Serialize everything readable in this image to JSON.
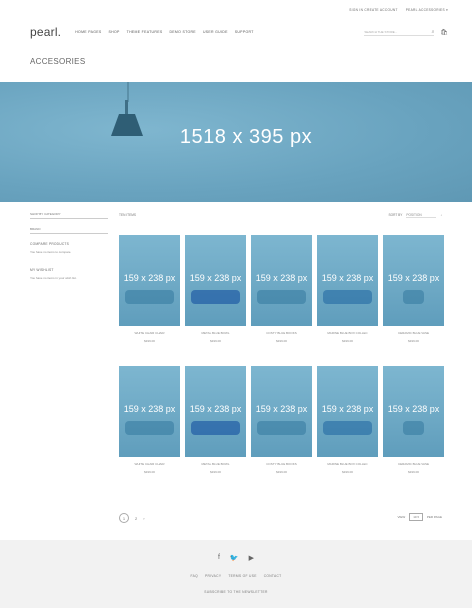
{
  "topbar": {
    "account": "SIGN IN  CREATE ACCOUNT",
    "language": "PEARL ACCESSORIES ▾"
  },
  "header": {
    "logo": "pearl.",
    "nav": [
      "HOME PAGES",
      "SHOP",
      "THEME FEATURES",
      "DEMO STORE",
      "USER GUIDE",
      "SUPPORT"
    ],
    "search_placeholder": "SEARCH THE STORE..."
  },
  "page_title": "ACCESORIES",
  "hero": {
    "placeholder": "1518 x 395 px"
  },
  "sidebar": {
    "select_1": "SHOP BY CATEGORY",
    "select_2": "BRAND",
    "compare_heading": "COMPARE PRODUCTS",
    "compare_text": "You have no items to compare.",
    "wishlist_heading": "MY WISHLIST",
    "wishlist_text": "You have no items in your wish list."
  },
  "toolbar": {
    "count": "TEN ITEMS",
    "sort_label": "SORT BY",
    "sort_value": "POSITION"
  },
  "products_row1": [
    {
      "placeholder": "159 x 238 px",
      "name": "WHITE CHAIR CHAIR",
      "price": "$199.00"
    },
    {
      "placeholder": "159 x 238 px",
      "name": "METAL BLUE BOWL",
      "price": "$199.00"
    },
    {
      "placeholder": "159 x 238 px",
      "name": "COSTY BLUE BOOKS",
      "price": "$199.00"
    },
    {
      "placeholder": "159 x 238 px",
      "name": "MARINE BLUE BOX COLLEC",
      "price": "$199.00"
    },
    {
      "placeholder": "159 x 238 px",
      "name": "CERAMIC BLUE VASE",
      "price": "$199.00"
    }
  ],
  "products_row2": [
    {
      "placeholder": "159 x 238 px",
      "name": "WHITE CHAIR CHAIR",
      "price": "$199.00"
    },
    {
      "placeholder": "159 x 238 px",
      "name": "METAL BLUE BOWL",
      "price": "$199.00"
    },
    {
      "placeholder": "159 x 238 px",
      "name": "COSTY BLUE BOOKS",
      "price": "$199.00"
    },
    {
      "placeholder": "159 x 238 px",
      "name": "MARINE BLUE BOX COLLEC",
      "price": "$199.00"
    },
    {
      "placeholder": "159 x 238 px",
      "name": "CERAMIC BLUE VASE",
      "price": "$199.00"
    }
  ],
  "pagination": {
    "current": "1",
    "next": "2",
    "arrow": "›"
  },
  "view": {
    "label": "VIEW",
    "value": "10 ▾",
    "suffix": "PER PAGE"
  },
  "footer": {
    "social": [
      "f",
      "🐦",
      "▶"
    ],
    "links": [
      "FAQ",
      "PRIVACY",
      "TERMS OF USE",
      "CONTACT"
    ],
    "newsletter": "SUBSCRIBE TO THE NEWSLETTER"
  },
  "colors": {
    "hero": "#6fa8c4",
    "footer": "#f2f2f2"
  }
}
